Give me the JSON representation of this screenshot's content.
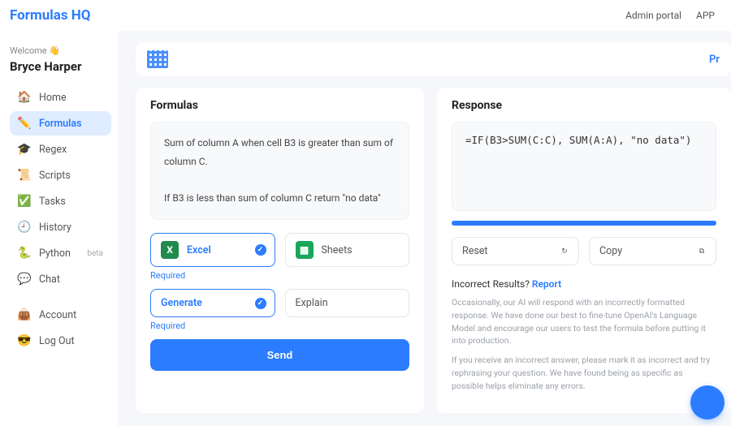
{
  "header": {
    "logo": "Formulas HQ",
    "links": {
      "admin": "Admin portal",
      "app": "APP"
    },
    "toolbar_right": "Pr"
  },
  "sidebar": {
    "welcome": "Welcome 👋",
    "username": "Bryce Harper",
    "items": [
      {
        "icon": "🏠",
        "label": "Home",
        "name": "home"
      },
      {
        "icon": "✏️",
        "label": "Formulas",
        "name": "formulas",
        "active": true
      },
      {
        "icon": "🎓",
        "label": "Regex",
        "name": "regex"
      },
      {
        "icon": "📜",
        "label": "Scripts",
        "name": "scripts"
      },
      {
        "icon": "✅",
        "label": "Tasks",
        "name": "tasks"
      },
      {
        "icon": "🕘",
        "label": "History",
        "name": "history"
      },
      {
        "icon": "🐍",
        "label": "Python",
        "name": "python",
        "badge": "beta"
      },
      {
        "icon": "💬",
        "label": "Chat",
        "name": "chat"
      }
    ],
    "account_items": [
      {
        "icon": "👜",
        "label": "Account",
        "name": "account"
      },
      {
        "icon": "😎",
        "label": "Log Out",
        "name": "logout"
      }
    ]
  },
  "formulas": {
    "title": "Formulas",
    "prompt_line1": "Sum of column A when cell B3 is greater than sum of column C.",
    "prompt_line2": "If B3 is less than sum of column C return \"no data\"",
    "platforms": {
      "excel": "Excel",
      "sheets": "Sheets"
    },
    "modes": {
      "generate": "Generate",
      "explain": "Explain"
    },
    "required": "Required",
    "send": "Send"
  },
  "response": {
    "title": "Response",
    "formula": "=IF(B3>SUM(C:C), SUM(A:A), \"no data\")",
    "reset": "Reset",
    "copy": "Copy",
    "incorrect_label": "Incorrect Results?",
    "report_link": "Report",
    "note1": "Occasionally, our AI will respond with an incorrectly formatted response. We have done our best to fine-tune OpenAI's Language Model and encourage our users to test the formula before putting it into production.",
    "note2": "If you receive an incorrect answer, please mark it as incorrect and try rephrasing your question. We have found being as specific as possible helps eliminate any errors."
  }
}
